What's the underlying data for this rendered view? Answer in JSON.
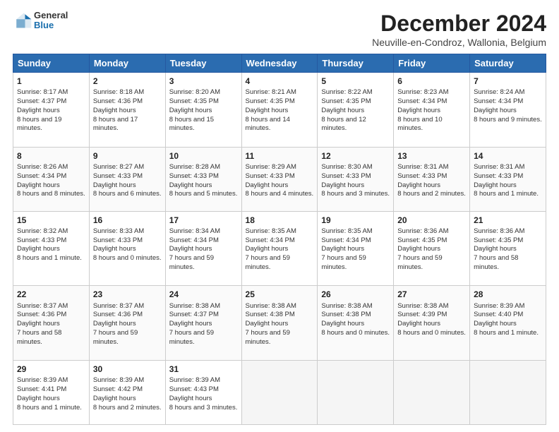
{
  "header": {
    "logo": {
      "general": "General",
      "blue": "Blue"
    },
    "title": "December 2024",
    "subtitle": "Neuville-en-Condroz, Wallonia, Belgium"
  },
  "days_of_week": [
    "Sunday",
    "Monday",
    "Tuesday",
    "Wednesday",
    "Thursday",
    "Friday",
    "Saturday"
  ],
  "weeks": [
    [
      {
        "day": "1",
        "sunrise": "8:17 AM",
        "sunset": "4:37 PM",
        "daylight": "8 hours and 19 minutes."
      },
      {
        "day": "2",
        "sunrise": "8:18 AM",
        "sunset": "4:36 PM",
        "daylight": "8 hours and 17 minutes."
      },
      {
        "day": "3",
        "sunrise": "8:20 AM",
        "sunset": "4:35 PM",
        "daylight": "8 hours and 15 minutes."
      },
      {
        "day": "4",
        "sunrise": "8:21 AM",
        "sunset": "4:35 PM",
        "daylight": "8 hours and 14 minutes."
      },
      {
        "day": "5",
        "sunrise": "8:22 AM",
        "sunset": "4:35 PM",
        "daylight": "8 hours and 12 minutes."
      },
      {
        "day": "6",
        "sunrise": "8:23 AM",
        "sunset": "4:34 PM",
        "daylight": "8 hours and 10 minutes."
      },
      {
        "day": "7",
        "sunrise": "8:24 AM",
        "sunset": "4:34 PM",
        "daylight": "8 hours and 9 minutes."
      }
    ],
    [
      {
        "day": "8",
        "sunrise": "8:26 AM",
        "sunset": "4:34 PM",
        "daylight": "8 hours and 8 minutes."
      },
      {
        "day": "9",
        "sunrise": "8:27 AM",
        "sunset": "4:33 PM",
        "daylight": "8 hours and 6 minutes."
      },
      {
        "day": "10",
        "sunrise": "8:28 AM",
        "sunset": "4:33 PM",
        "daylight": "8 hours and 5 minutes."
      },
      {
        "day": "11",
        "sunrise": "8:29 AM",
        "sunset": "4:33 PM",
        "daylight": "8 hours and 4 minutes."
      },
      {
        "day": "12",
        "sunrise": "8:30 AM",
        "sunset": "4:33 PM",
        "daylight": "8 hours and 3 minutes."
      },
      {
        "day": "13",
        "sunrise": "8:31 AM",
        "sunset": "4:33 PM",
        "daylight": "8 hours and 2 minutes."
      },
      {
        "day": "14",
        "sunrise": "8:31 AM",
        "sunset": "4:33 PM",
        "daylight": "8 hours and 1 minute."
      }
    ],
    [
      {
        "day": "15",
        "sunrise": "8:32 AM",
        "sunset": "4:33 PM",
        "daylight": "8 hours and 1 minute."
      },
      {
        "day": "16",
        "sunrise": "8:33 AM",
        "sunset": "4:33 PM",
        "daylight": "8 hours and 0 minutes."
      },
      {
        "day": "17",
        "sunrise": "8:34 AM",
        "sunset": "4:34 PM",
        "daylight": "7 hours and 59 minutes."
      },
      {
        "day": "18",
        "sunrise": "8:35 AM",
        "sunset": "4:34 PM",
        "daylight": "7 hours and 59 minutes."
      },
      {
        "day": "19",
        "sunrise": "8:35 AM",
        "sunset": "4:34 PM",
        "daylight": "7 hours and 59 minutes."
      },
      {
        "day": "20",
        "sunrise": "8:36 AM",
        "sunset": "4:35 PM",
        "daylight": "7 hours and 59 minutes."
      },
      {
        "day": "21",
        "sunrise": "8:36 AM",
        "sunset": "4:35 PM",
        "daylight": "7 hours and 58 minutes."
      }
    ],
    [
      {
        "day": "22",
        "sunrise": "8:37 AM",
        "sunset": "4:36 PM",
        "daylight": "7 hours and 58 minutes."
      },
      {
        "day": "23",
        "sunrise": "8:37 AM",
        "sunset": "4:36 PM",
        "daylight": "7 hours and 59 minutes."
      },
      {
        "day": "24",
        "sunrise": "8:38 AM",
        "sunset": "4:37 PM",
        "daylight": "7 hours and 59 minutes."
      },
      {
        "day": "25",
        "sunrise": "8:38 AM",
        "sunset": "4:38 PM",
        "daylight": "7 hours and 59 minutes."
      },
      {
        "day": "26",
        "sunrise": "8:38 AM",
        "sunset": "4:38 PM",
        "daylight": "8 hours and 0 minutes."
      },
      {
        "day": "27",
        "sunrise": "8:38 AM",
        "sunset": "4:39 PM",
        "daylight": "8 hours and 0 minutes."
      },
      {
        "day": "28",
        "sunrise": "8:39 AM",
        "sunset": "4:40 PM",
        "daylight": "8 hours and 1 minute."
      }
    ],
    [
      {
        "day": "29",
        "sunrise": "8:39 AM",
        "sunset": "4:41 PM",
        "daylight": "8 hours and 1 minute."
      },
      {
        "day": "30",
        "sunrise": "8:39 AM",
        "sunset": "4:42 PM",
        "daylight": "8 hours and 2 minutes."
      },
      {
        "day": "31",
        "sunrise": "8:39 AM",
        "sunset": "4:43 PM",
        "daylight": "8 hours and 3 minutes."
      },
      null,
      null,
      null,
      null
    ]
  ],
  "labels": {
    "sunrise": "Sunrise:",
    "sunset": "Sunset:",
    "daylight": "Daylight hours"
  }
}
